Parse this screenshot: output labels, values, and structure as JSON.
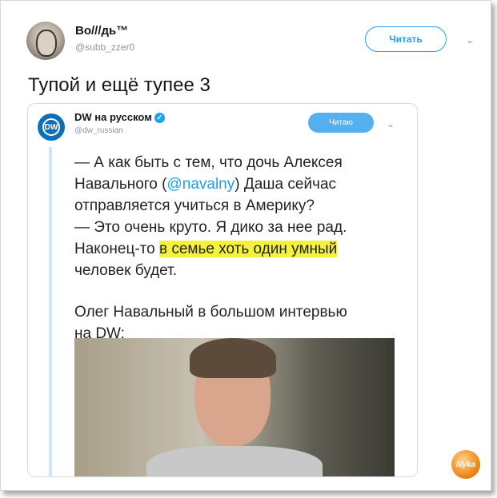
{
  "tweet": {
    "author_name": "Во///дь™",
    "author_handle": "@subb_zzer0",
    "follow_label": "Читать",
    "text": "Тупой и ещё тупее 3"
  },
  "quoted": {
    "author_name": "DW на русском",
    "author_handle": "@dw_russian",
    "follow_label": "Читаю",
    "avatar_text": "DW",
    "body": {
      "l1": "— А как быть с тем, что дочь Алексея",
      "l2_pre": "Навального (",
      "l2_mention": "@navalny",
      "l2_post": ") Даша сейчас",
      "l3": "отправляется учиться в Америку?",
      "l4": "— Это очень круто. Я дико за нее рад.",
      "l5_pre": "Наконец-то ",
      "l5_highlight": "в семье хоть один умный",
      "l6": "человек будет.",
      "p2_l1": "Олег Навальный в большом интервью",
      "p2_l2": "на DW:"
    }
  },
  "watermark": "Nyka",
  "colors": {
    "accent": "#1da1f2",
    "highlight": "#f6f23a"
  }
}
